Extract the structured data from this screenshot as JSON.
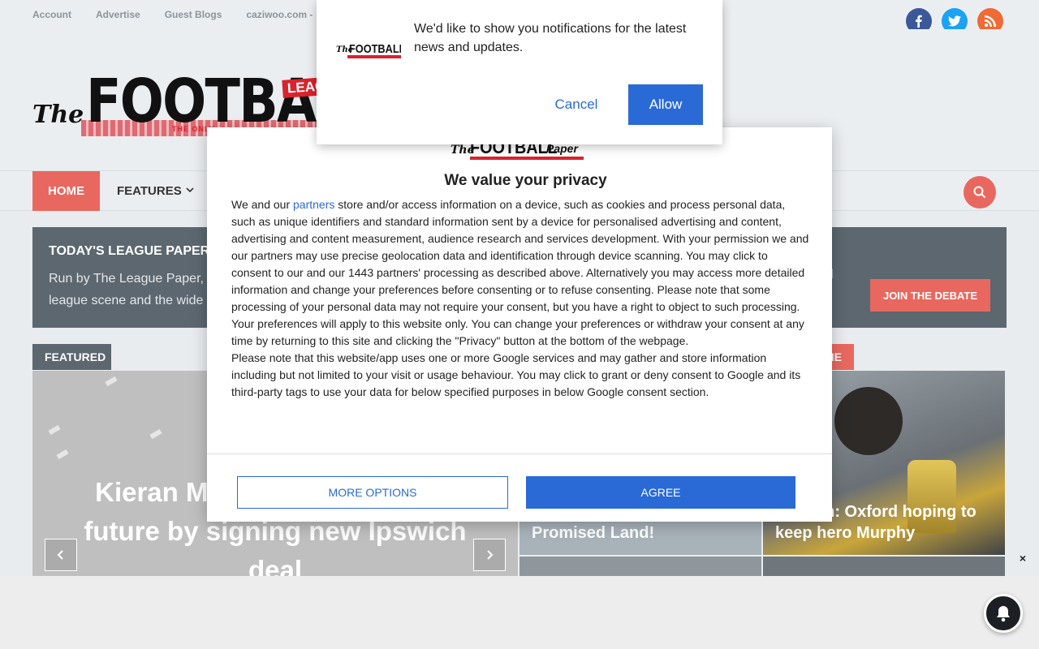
{
  "topbar": {
    "links": [
      "Account",
      "Advertise",
      "Guest Blogs",
      "caziwoo.com -"
    ]
  },
  "socials": [
    {
      "name": "facebook-icon",
      "glyph": "f"
    },
    {
      "name": "twitter-icon",
      "glyph": "t"
    },
    {
      "name": "rss-icon",
      "glyph": ")"
    }
  ],
  "logo": {
    "the": "The",
    "word": "FOOTBALL",
    "league": "LEAGUE",
    "tagline": "THE ONLY"
  },
  "nav": {
    "home": "HOME",
    "features": "FEATURES"
  },
  "promo": {
    "title": "TODAY'S LEAGUE PAPER VE",
    "text_line1": "Run by The League Paper,",
    "text_line2": "league scene and the wide",
    "text_right": "l",
    "button": "JOIN THE DEBATE"
  },
  "featured": {
    "tag": "FEATURED",
    "slide_title": "Kieran M… speculation over future by signing new Ipswich deal",
    "prev_glyph": "‹",
    "next_glyph": "›"
  },
  "side": {
    "tag": "NE",
    "card1_title": "Promised Land!",
    "card2_title": "…gham: Oxford hoping to keep hero Murphy"
  },
  "push": {
    "message": "We'd like to show you notifications for the latest news and updates.",
    "cancel": "Cancel",
    "allow": "Allow"
  },
  "consent": {
    "logo_the": "The",
    "logo_word": "FOOTBALL",
    "logo_paper": "Paper",
    "title": "We value your privacy",
    "intro": "We and our",
    "partners_link": "partners",
    "body1": " store and/or access information on a device, such as cookies and process personal data, such as unique identifiers and standard information sent by a device for personalised advertising and content, advertising and content measurement, audience research and services development. With your permission we and our partners may use precise geolocation data and identification through device scanning. You may click to consent to our and our 1443 partners' processing as described above. Alternatively you may access more detailed information and change your preferences before consenting or to refuse consenting. Please note that some processing of your personal data may not require your consent, but you have a right to object to such processing. Your preferences will apply to this website only. You can change your preferences or withdraw your consent at any time by returning to this site and clicking the \"Privacy\" button at the bottom of the webpage.",
    "body2": "Please note that this website/app uses one or more Google services and may gather and store information including but not limited to your visit or usage behaviour. You may click to grant or deny consent to Google and its third-party tags to use your data for below specified purposes in below Google consent section.",
    "more_options": "MORE OPTIONS",
    "agree": "AGREE"
  },
  "ad": {
    "close": "×"
  },
  "colors": {
    "accent": "#e8685f",
    "consent_blue": "#2a6ad6",
    "promo_bg": "#5c6770"
  }
}
